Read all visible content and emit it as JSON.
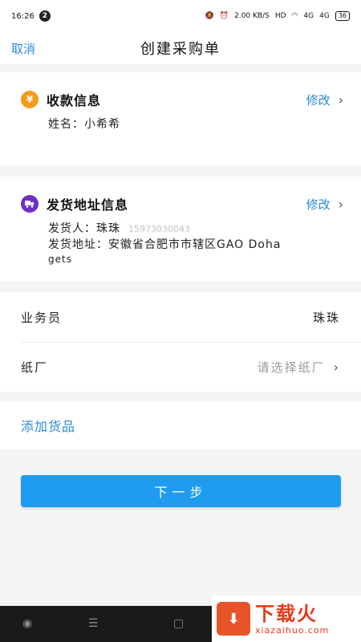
{
  "status_bar": {
    "time": "16:26",
    "notification_count": "2",
    "net_speed": "2.00 KB/S",
    "hd_label": "HD",
    "signal_1": "4G",
    "signal_2": "4G",
    "battery": "36"
  },
  "nav": {
    "cancel_label": "取消",
    "title": "创建采购单"
  },
  "payment": {
    "icon_glyph": "¥",
    "title": "收款信息",
    "edit_label": "修改",
    "name_line": "姓名：小希希"
  },
  "shipping": {
    "title": "发货地址信息",
    "edit_label": "修改",
    "sender_label": "发货人：珠珠",
    "sender_phone": "15973030043",
    "address_line_1": "发货地址：安徽省合肥市市辖区GAO Doha",
    "address_line_2": "gets"
  },
  "staff": {
    "salesperson_label": "业务员",
    "salesperson_value": "珠珠",
    "factory_label": "纸厂",
    "factory_placeholder": "请选择纸厂"
  },
  "add_goods_label": "添加货品",
  "next_button_label": "下一步",
  "watermark": {
    "main": "下载火",
    "sub": "xiazaihuo.com"
  },
  "colors": {
    "accent": "#2a8bd8",
    "button": "#1f9cf0",
    "yen_icon": "#f59a1b",
    "truck_icon": "#6d2fc7"
  }
}
